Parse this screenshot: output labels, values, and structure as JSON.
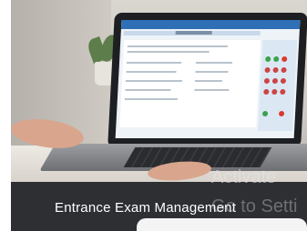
{
  "caption": {
    "title": "Entrance Exam Management"
  },
  "watermark": {
    "line1": "Activate",
    "line2": "Go to Setti"
  },
  "colors": {
    "caption_bar": "#2d2f33",
    "screen_header": "#2e6fb5"
  }
}
